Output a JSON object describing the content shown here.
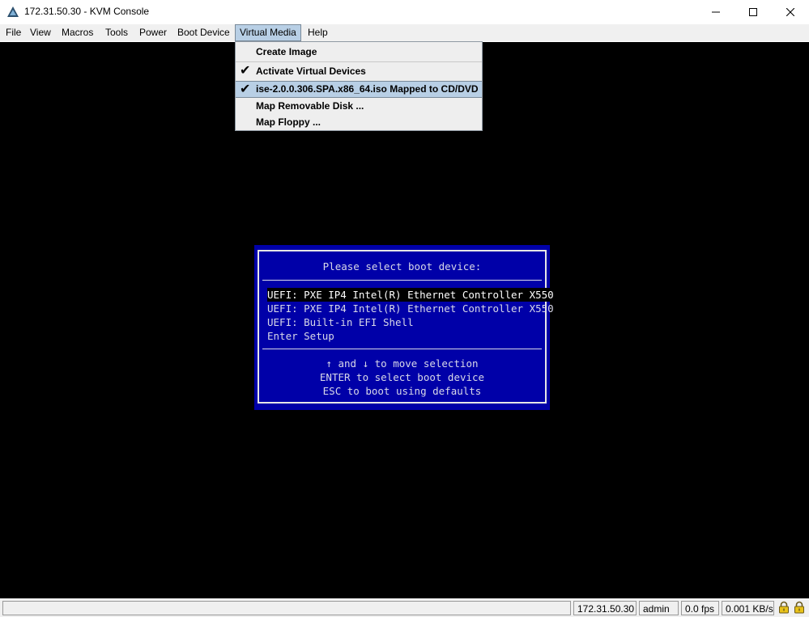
{
  "window": {
    "title": "172.31.50.30 - KVM Console",
    "icon": "triangle-app-icon",
    "controls": [
      "minimize-icon",
      "maximize-icon",
      "close-icon"
    ]
  },
  "menubar": {
    "items": [
      "File",
      "View",
      "Macros",
      "Tools",
      "Power",
      "Boot Device",
      "Virtual Media",
      "Help"
    ],
    "active": "Virtual Media"
  },
  "virtual_media_menu": {
    "items": [
      {
        "label": "Create Image",
        "checked": false
      },
      {
        "label": "Activate Virtual Devices",
        "checked": true
      },
      {
        "label": "ise-2.0.0.306.SPA.x86_64.iso Mapped to CD/DVD",
        "checked": true,
        "highlighted": true
      },
      {
        "label": "Map Removable Disk ...",
        "checked": false
      },
      {
        "label": "Map Floppy ...",
        "checked": false
      }
    ]
  },
  "boot_menu": {
    "title": "Please select boot device:",
    "options": [
      "UEFI: PXE IP4 Intel(R) Ethernet Controller X550",
      "UEFI: PXE IP4 Intel(R) Ethernet Controller X550",
      "UEFI: Built-in EFI Shell",
      "Enter Setup"
    ],
    "selected_index": 0,
    "help": [
      "↑ and ↓ to move selection",
      "ENTER to select boot device",
      "ESC to boot using defaults"
    ],
    "colors": {
      "background": "#0000a8",
      "text": "#d8d8e8",
      "selected_bg": "#000000"
    }
  },
  "statusbar": {
    "ip": "172.31.50.30",
    "user": "admin",
    "fps": "0.0 fps",
    "rate": "0.001 KB/s",
    "icons": [
      "lock-icon",
      "lock-icon"
    ]
  }
}
